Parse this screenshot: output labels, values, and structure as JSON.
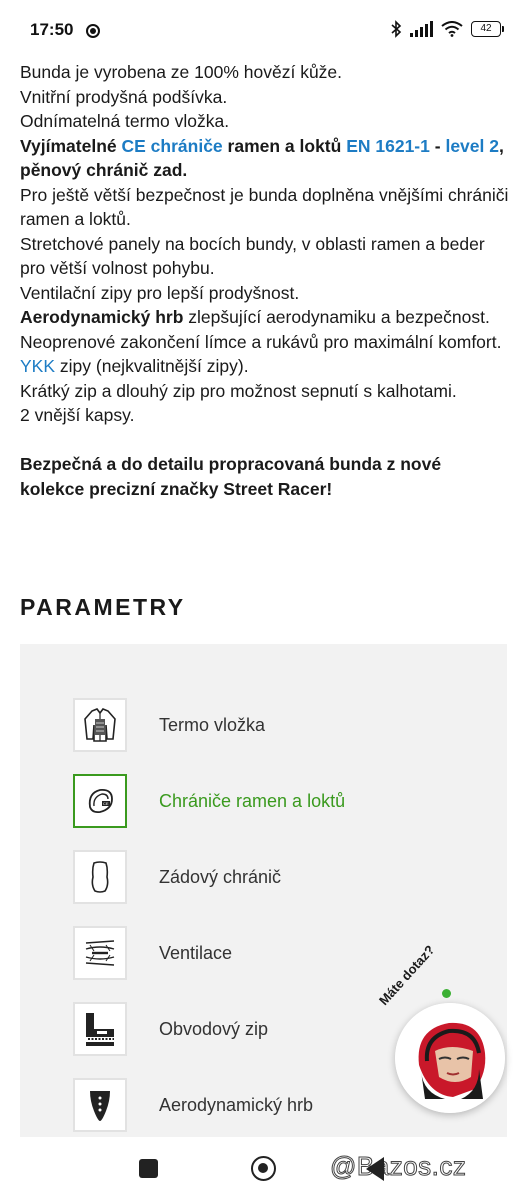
{
  "status_bar": {
    "time": "17:50",
    "battery": "42"
  },
  "description": {
    "line1": "Bunda je vyrobena ze 100% hovězí kůže.",
    "line2": "Vnitřní prodyšná podšívka.",
    "line3": "Odnímatelná termo vložka.",
    "protector_a": "Vyjímatelné",
    "protector_link1": "CE chrániče",
    "protector_b": "ramen a loktů",
    "protector_link2": "EN 1621-1",
    "protector_dash": "-",
    "protector_link3": "level 2",
    "protector_c": ", pěnový chránič zad.",
    "line5": "Pro ještě větší bezpečnost je bunda doplněna vnějšími chrániči ramen a loktů.",
    "line6": "Stretchové panely na bocích bundy, v oblasti ramen a beder pro větší volnost pohybu.",
    "line7": "Ventilační zipy pro lepší prodyšnost.",
    "aero_bold": "Aerodynamický hrb",
    "aero_rest": "zlepšující aerodynamiku a bezpečnost.",
    "line9": "Neoprenové zakončení límce a rukávů pro maximální komfort.",
    "ykk_link": "YKK",
    "ykk_rest": "zipy (nejkvalitnější zipy).",
    "line11": "Krátký zip a dlouhý zip pro možnost sepnutí s kalhotami.",
    "line12": "2 vnější kapsy.",
    "closing": "Bezpečná a do detailu propracovaná bunda z nové kolekce precizní značky Street Racer!"
  },
  "parameters": {
    "title": "PARAMETRY",
    "items": [
      {
        "label": "Termo vložka",
        "icon": "thermal-liner-icon",
        "active": false
      },
      {
        "label": "Chrániče ramen a loktů",
        "icon": "shoulder-elbow-protector-icon",
        "active": true
      },
      {
        "label": "Zádový chránič",
        "icon": "back-protector-icon",
        "active": false
      },
      {
        "label": "Ventilace",
        "icon": "ventilation-icon",
        "active": false
      },
      {
        "label": "Obvodový zip",
        "icon": "connection-zip-icon",
        "active": false
      },
      {
        "label": "Aerodynamický hrb",
        "icon": "aero-hump-icon",
        "active": false
      }
    ]
  },
  "chat": {
    "label": "Máte dotaz?"
  },
  "watermark": "@Bazos.cz",
  "colors": {
    "link": "#1d7cc4",
    "active": "#3a9a1e",
    "panel": "#f2f2f2"
  }
}
